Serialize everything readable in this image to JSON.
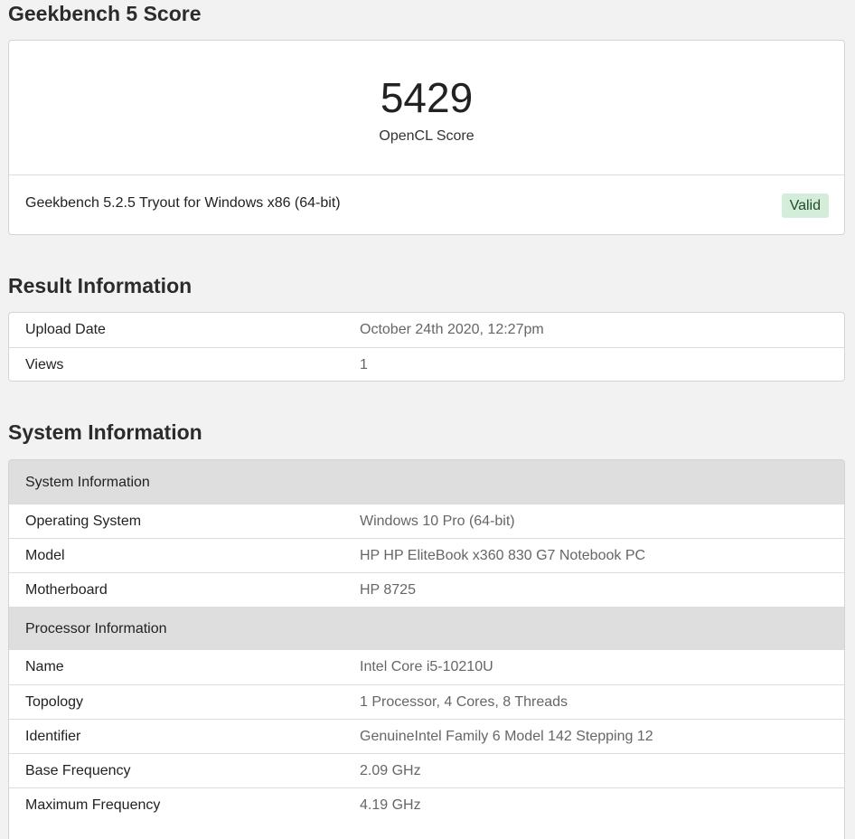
{
  "score_section": {
    "title": "Geekbench 5 Score",
    "score": "5429",
    "score_label": "OpenCL Score",
    "version": "Geekbench 5.2.5 Tryout for Windows x86 (64-bit)",
    "status": "Valid"
  },
  "result_section": {
    "title": "Result Information",
    "rows": [
      {
        "key": "Upload Date",
        "value": "October 24th 2020, 12:27pm"
      },
      {
        "key": "Views",
        "value": "1"
      }
    ]
  },
  "system_section": {
    "title": "System Information",
    "system_group": {
      "header": "System Information",
      "rows": [
        {
          "key": "Operating System",
          "value": "Windows 10 Pro (64-bit)"
        },
        {
          "key": "Model",
          "value": "HP HP EliteBook x360 830 G7 Notebook PC"
        },
        {
          "key": "Motherboard",
          "value": "HP 8725"
        }
      ]
    },
    "processor_group": {
      "header": "Processor Information",
      "rows": [
        {
          "key": "Name",
          "value": "Intel Core i5-10210U"
        },
        {
          "key": "Topology",
          "value": "1 Processor, 4 Cores, 8 Threads"
        },
        {
          "key": "Identifier",
          "value": "GenuineIntel Family 6 Model 142 Stepping 12"
        },
        {
          "key": "Base Frequency",
          "value": "2.09 GHz"
        },
        {
          "key": "Maximum Frequency",
          "value": "4.19 GHz"
        }
      ]
    }
  }
}
